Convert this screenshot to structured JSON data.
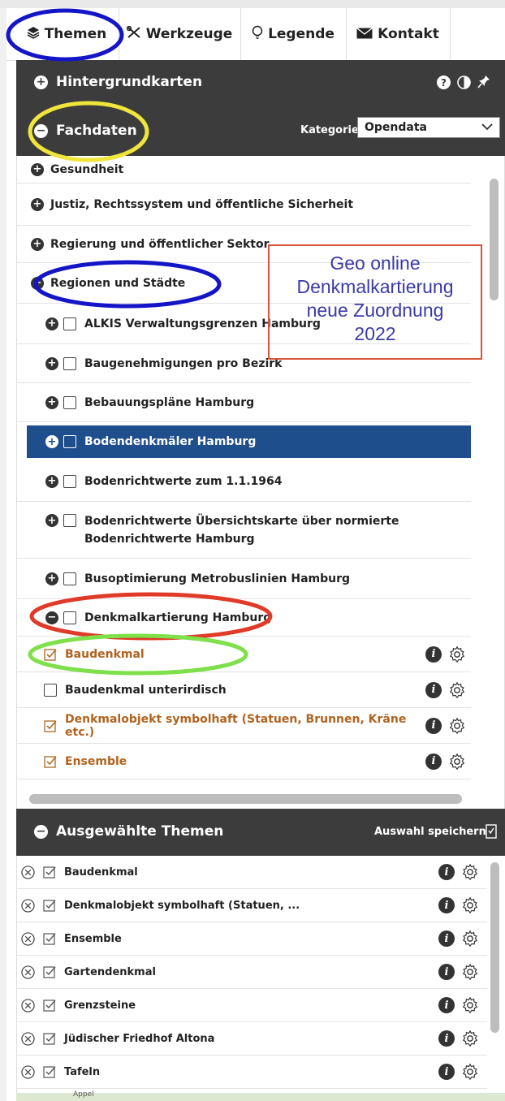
{
  "tabs": [
    {
      "label": "Themen",
      "icon": "layers-icon"
    },
    {
      "label": "Werkzeuge",
      "icon": "tools-icon"
    },
    {
      "label": "Legende",
      "icon": "bulb-icon"
    },
    {
      "label": "Kontakt",
      "icon": "envelope-icon"
    }
  ],
  "background_maps": {
    "title": "Hintergrundkarten"
  },
  "fachdaten": {
    "title": "Fachdaten",
    "category_label": "Kategorie",
    "category_value": "Opendata"
  },
  "categories": [
    "Gesundheit",
    "Justiz, Rechtssystem und öffentliche Sicherheit",
    "Regierung und öffentlicher Sektor",
    "Regionen und Städte"
  ],
  "layers": [
    "ALKIS Verwaltungsgrenzen Hamburg",
    "Baugenehmigungen pro Bezirk",
    "Bebauungspläne Hamburg",
    "Bodendenkmäler Hamburg",
    "Bodenrichtwerte zum 1.1.1964",
    "Bodenrichtwerte Übersichtskarte über normierte Bodenrichtwerte Hamburg",
    "Busoptimierung Metrobuslinien Hamburg",
    "Denkmalkartierung Hamburg"
  ],
  "sublayers": [
    {
      "label": "Baudenkmal",
      "checked": true
    },
    {
      "label": "Baudenkmal unterirdisch",
      "checked": false
    },
    {
      "label": "Denkmalobjekt symbolhaft (Statuen, Brunnen, Kräne etc.)",
      "checked": true
    },
    {
      "label": "Ensemble",
      "checked": true
    }
  ],
  "annotation": {
    "line1": "Geo online",
    "line2": "Denkmalkartierung",
    "line3": "neue Zuordnung",
    "line4": "2022"
  },
  "selected": {
    "title": "Ausgewählte Themen",
    "save_label": "Auswahl speichern",
    "items": [
      "Baudenkmal",
      "Denkmalobjekt symbolhaft (Statuen, ...",
      "Ensemble",
      "Gartendenkmal",
      "Grenzsteine",
      "Jüdischer Friedhof Altona",
      "Tafeln"
    ]
  },
  "map_bottom": {
    "label": "Appel"
  },
  "colors": {
    "dark_header": "#3c3c3c",
    "active_row": "#1f4e8c",
    "checked_text": "#b0631e",
    "annot_blue": "#1515c8",
    "annot_yellow": "#f0e53a",
    "annot_red": "#e03a28",
    "annot_green": "#7ee04a",
    "annot_box": "#d9533a"
  }
}
